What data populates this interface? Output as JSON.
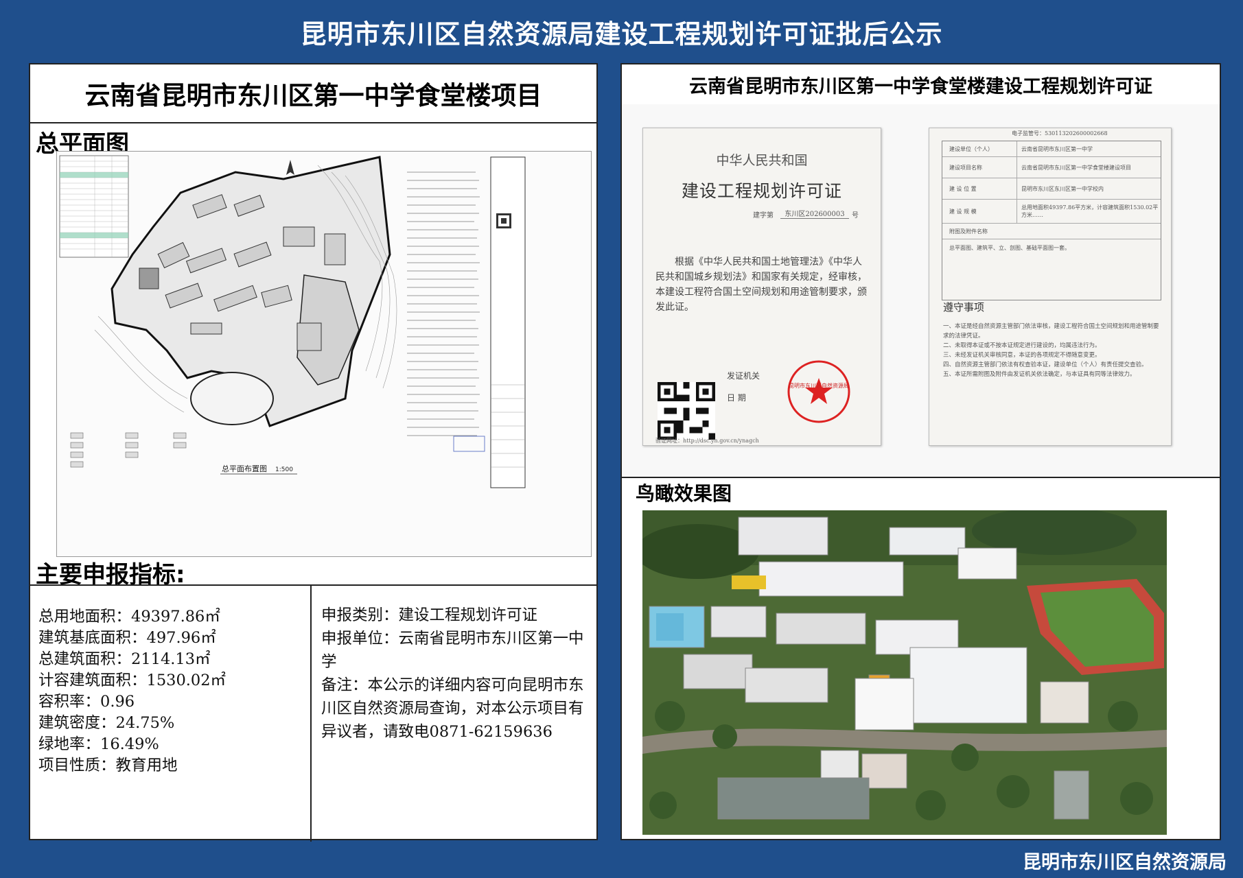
{
  "header": {
    "title": "昆明市东川区自然资源局建设工程规划许可证批后公示"
  },
  "footer": {
    "text": "昆明市东川区自然资源局"
  },
  "left": {
    "project_title": "云南省昆明市东川区第一中学食堂楼项目",
    "plan_heading": "总平面图",
    "plan_caption": "总平面布置图",
    "plan_scale": "1:500",
    "specs_heading": "主要申报指标:",
    "specs": [
      "总用地面积：49397.86㎡",
      "建筑基底面积：497.96㎡",
      "总建筑面积：2114.13㎡",
      "计容建筑面积：1530.02㎡",
      "容积率：0.96",
      "建筑密度：24.75%",
      "绿地率：16.49%",
      "项目性质：教育用地"
    ],
    "notes": [
      "申报类别：建设工程规划许可证",
      "申报单位：云南省昆明市东川区第一中学",
      "备注：本公示的详细内容可向昆明市东川区自然资源局查询，对本公示项目有异议者，请致电0871-62159636"
    ]
  },
  "right": {
    "permit_title": "云南省昆明市东川区第一中学食堂楼建设工程规划许可证",
    "cert1": {
      "country": "中华人民共和国",
      "name": "建设工程规划许可证",
      "number_label": "建字第",
      "number": "东川区202600003",
      "number_suffix": "号",
      "body": "根据《中华人民共和国土地管理法》《中华人民共和国城乡规划法》和国家有关规定，经审核，本建设工程符合国土空间规划和用途管制要求，颁发此证。",
      "issuer_label": "发证机关",
      "date_label": "日 期",
      "seal_text": "昆明市东川区自然资源局",
      "verify": "验证网址：http://dsc.yn.gov.cn/ynagch"
    },
    "cert2": {
      "e_cert_no": "电子监管号：530113202600002668",
      "rows": [
        {
          "label": "建设单位（个人）",
          "value": "云南省昆明市东川区第一中学"
        },
        {
          "label": "建设项目名称",
          "value": "云南省昆明市东川区第一中学食堂楼建设项目"
        },
        {
          "label": "建 设 位 置",
          "value": "昆明市东川区东川区第一中学校内"
        },
        {
          "label": "建 设 规 模",
          "value": "总用地面积49397.86平方米，计容建筑面积1530.02平方米……"
        }
      ],
      "attach_label": "附图及附件名称",
      "attach_text": "总平面图、建筑平、立、剖图、基础平面图一套。",
      "rules_title": "遵守事项",
      "rules": [
        "一、本证是经自然资源主管部门依法审核，建设工程符合国土空间规划和用途管制要求的法律凭证。",
        "二、未取得本证或不按本证规定进行建设的，均属违法行为。",
        "三、未经发证机关审核同意，本证的各项规定不得随意变更。",
        "四、自然资源主管部门依法有权查验本证，建设单位（个人）有责任提交查验。",
        "五、本证所需附图及附件由发证机关依法确定，与本证具有同等法律效力。"
      ]
    },
    "aerial_heading": "鸟瞰效果图"
  }
}
